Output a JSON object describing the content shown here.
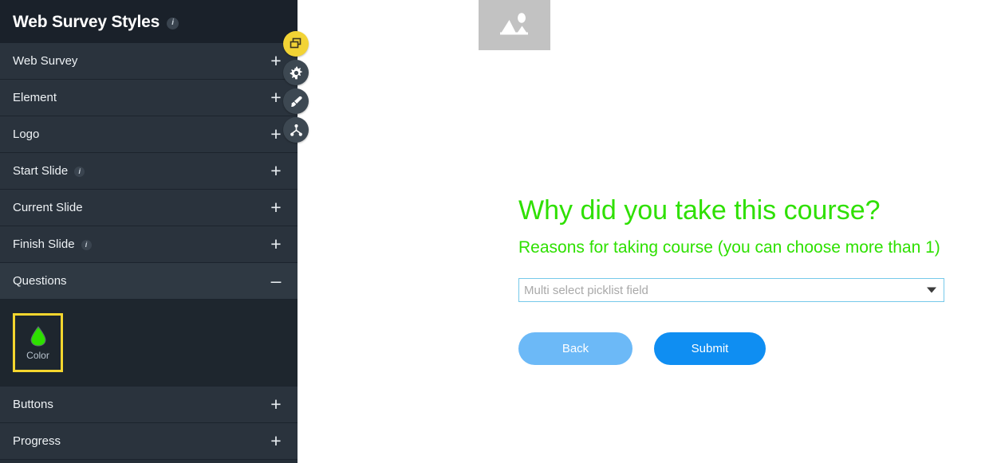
{
  "sidebar": {
    "title": "Web Survey Styles",
    "title_info_icon": "info-icon",
    "items": [
      {
        "label": "Web Survey",
        "toggle": "+",
        "has_info": false,
        "expanded": false
      },
      {
        "label": "Element",
        "toggle": "+",
        "has_info": false,
        "expanded": false
      },
      {
        "label": "Logo",
        "toggle": "+",
        "has_info": false,
        "expanded": false
      },
      {
        "label": "Start Slide",
        "toggle": "+",
        "has_info": true,
        "expanded": false
      },
      {
        "label": "Current Slide",
        "toggle": "+",
        "has_info": false,
        "expanded": false
      },
      {
        "label": "Finish Slide",
        "toggle": "+",
        "has_info": true,
        "expanded": false
      },
      {
        "label": "Questions",
        "toggle": "–",
        "has_info": false,
        "expanded": true
      },
      {
        "label": "Buttons",
        "toggle": "+",
        "has_info": false,
        "expanded": false
      },
      {
        "label": "Progress",
        "toggle": "+",
        "has_info": false,
        "expanded": false
      }
    ],
    "questions_panel": {
      "swatch_label": "Color",
      "swatch_icon": "droplet-icon",
      "swatch_color": "#2ee000",
      "selection_border_color": "#f5d62e"
    },
    "info_symbol": "i"
  },
  "fab_buttons": [
    {
      "name": "duplicate-icon",
      "color": "#f2d335",
      "active": true
    },
    {
      "name": "gear-icon",
      "color": "#3d4852",
      "active": false
    },
    {
      "name": "brush-icon",
      "color": "#3d4852",
      "active": false
    },
    {
      "name": "share-icon",
      "color": "#3d4852",
      "active": false
    }
  ],
  "preview": {
    "hero_image_alt": "image-placeholder-icon",
    "title": "Why did you take this course?",
    "subtitle": "Reasons for taking course (you can choose more than 1)",
    "picklist": {
      "placeholder": "Multi select picklist field",
      "value": "",
      "arrow_icon": "chevron-down-icon"
    },
    "buttons": {
      "back_label": "Back",
      "submit_label": "Submit"
    }
  },
  "colors": {
    "accent_green": "#2ee000",
    "submit_blue": "#0f8ef2",
    "back_blue": "#6cb9f7",
    "field_border": "#76c9ea",
    "highlight_yellow": "#f5d62e",
    "sidebar_bg": "#2a333d",
    "sidebar_header_bg": "#1a212a",
    "panel_bg": "#1e262e"
  }
}
